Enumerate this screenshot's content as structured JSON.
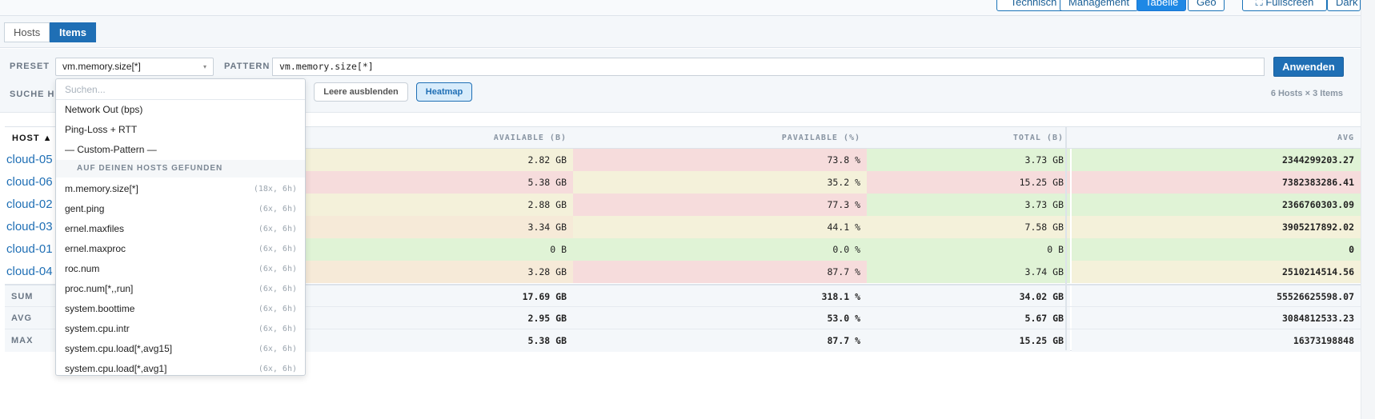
{
  "view_buttons": [
    {
      "label": "Technisch",
      "active": false
    },
    {
      "label": "Management",
      "active": false
    },
    {
      "label": "Tabelle",
      "active": true
    },
    {
      "label": "Geo",
      "active": false
    },
    {
      "label": "⛶ Fullscreen",
      "active": false
    },
    {
      "label": "Dark",
      "active": false
    }
  ],
  "tabs": [
    {
      "label": "Hosts",
      "active": false
    },
    {
      "label": "Items",
      "active": true
    }
  ],
  "filters": {
    "preset_label": "PRESET",
    "preset_value": "vm.memory.size[*]",
    "pattern_label": "PATTERN",
    "pattern_value": "vm.memory.size[*]",
    "apply_label": "Anwenden",
    "search_label": "SUCHE HO",
    "hide_empty_label": "Leere ausblenden",
    "heatmap_label": "Heatmap",
    "host_count": "6 Hosts × 3 Items"
  },
  "table": {
    "headers": {
      "host": "HOST ▲",
      "available": "AVAILABLE (B)",
      "pavailable": "PAVAILABLE (%)",
      "total": "TOTAL (B)",
      "avg": "AVG"
    },
    "rows": [
      {
        "host": "cloud-05",
        "available": "2.82 GB",
        "pavailable": "73.8 %",
        "total": "3.73 GB",
        "avg": "2344299203.27"
      },
      {
        "host": "cloud-06",
        "available": "5.38 GB",
        "pavailable": "35.2 %",
        "total": "15.25 GB",
        "avg": "7382383286.41"
      },
      {
        "host": "cloud-02",
        "available": "2.88 GB",
        "pavailable": "77.3 %",
        "total": "3.73 GB",
        "avg": "2366760303.09"
      },
      {
        "host": "cloud-03",
        "available": "3.34 GB",
        "pavailable": "44.1 %",
        "total": "7.58 GB",
        "avg": "3905217892.02"
      },
      {
        "host": "cloud-01",
        "available": "0 B",
        "pavailable": "0.0 %",
        "total": "0 B",
        "avg": "0"
      },
      {
        "host": "cloud-04",
        "available": "3.28 GB",
        "pavailable": "87.7 %",
        "total": "3.74 GB",
        "avg": "2510214514.56"
      }
    ],
    "aggregates": [
      {
        "label": "SUM",
        "available": "17.69 GB",
        "pavailable": "318.1 %",
        "total": "34.02 GB",
        "avg": "55526625598.07"
      },
      {
        "label": "AVG",
        "available": "2.95 GB",
        "pavailable": "53.0 %",
        "total": "5.67 GB",
        "avg": "3084812533.23"
      },
      {
        "label": "MAX",
        "available": "5.38 GB",
        "pavailable": "87.7 %",
        "total": "15.25 GB",
        "avg": "16373198848"
      }
    ]
  },
  "dropdown": {
    "search_placeholder": "Suchen...",
    "items": [
      {
        "label": "Network Out (bps)"
      },
      {
        "label": "Ping-Loss + RTT"
      },
      {
        "label": "— Custom-Pattern —"
      }
    ],
    "group_label": "AUF DEINEN HOSTS GEFUNDEN",
    "found_items": [
      {
        "label": "m.memory.size[*]",
        "meta": "(18x, 6h)"
      },
      {
        "label": "gent.ping",
        "meta": "(6x, 6h)"
      },
      {
        "label": "ernel.maxfiles",
        "meta": "(6x, 6h)"
      },
      {
        "label": "ernel.maxproc",
        "meta": "(6x, 6h)"
      },
      {
        "label": "roc.num",
        "meta": "(6x, 6h)"
      },
      {
        "label": "proc.num[*,,run]",
        "meta": "(6x, 6h)"
      },
      {
        "label": "system.boottime",
        "meta": "(6x, 6h)"
      },
      {
        "label": "system.cpu.intr",
        "meta": "(6x, 6h)"
      },
      {
        "label": "system.cpu.load[*,avg15]",
        "meta": "(6x, 6h)"
      },
      {
        "label": "system.cpu.load[*,avg1]",
        "meta": "(6x, 6h)"
      }
    ]
  }
}
